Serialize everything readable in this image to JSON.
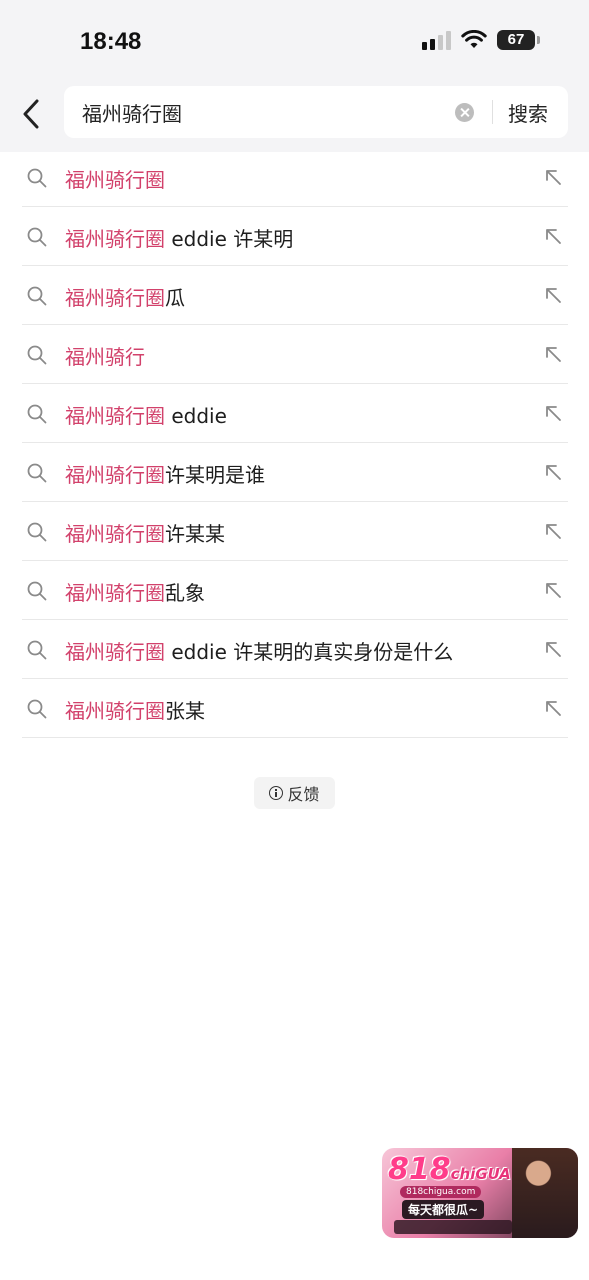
{
  "status_bar": {
    "time": "18:48",
    "battery": "67"
  },
  "header": {
    "back_icon": "chevron-left-icon",
    "search": {
      "value": "福州骑行圈",
      "clear_icon": "clear-circle-icon",
      "submit_label": "搜索"
    }
  },
  "suggestions": [
    {
      "highlight": "福州骑行圈",
      "rest": ""
    },
    {
      "highlight": "福州骑行圈",
      "rest": " eddie 许某明"
    },
    {
      "highlight": "福州骑行圈",
      "rest": "瓜"
    },
    {
      "highlight": "福州骑行",
      "rest": ""
    },
    {
      "highlight": "福州骑行圈",
      "rest": " eddie"
    },
    {
      "highlight": "福州骑行圈",
      "rest": "许某明是谁"
    },
    {
      "highlight": "福州骑行圈",
      "rest": "许某某"
    },
    {
      "highlight": "福州骑行圈",
      "rest": "乱象"
    },
    {
      "highlight": "福州骑行圈",
      "rest": " eddie 许某明的真实身份是什么"
    },
    {
      "highlight": "福州骑行圈",
      "rest": "张某"
    }
  ],
  "feedback": {
    "icon": "info-icon",
    "label": "反馈"
  },
  "watermark": {
    "logo": "818",
    "logo_sub": "chiGUA",
    "url": "818chigua.com",
    "slogan": "每天都很瓜~"
  },
  "colors": {
    "highlight": "#d2416b",
    "header_bg": "#f4f4f6"
  }
}
